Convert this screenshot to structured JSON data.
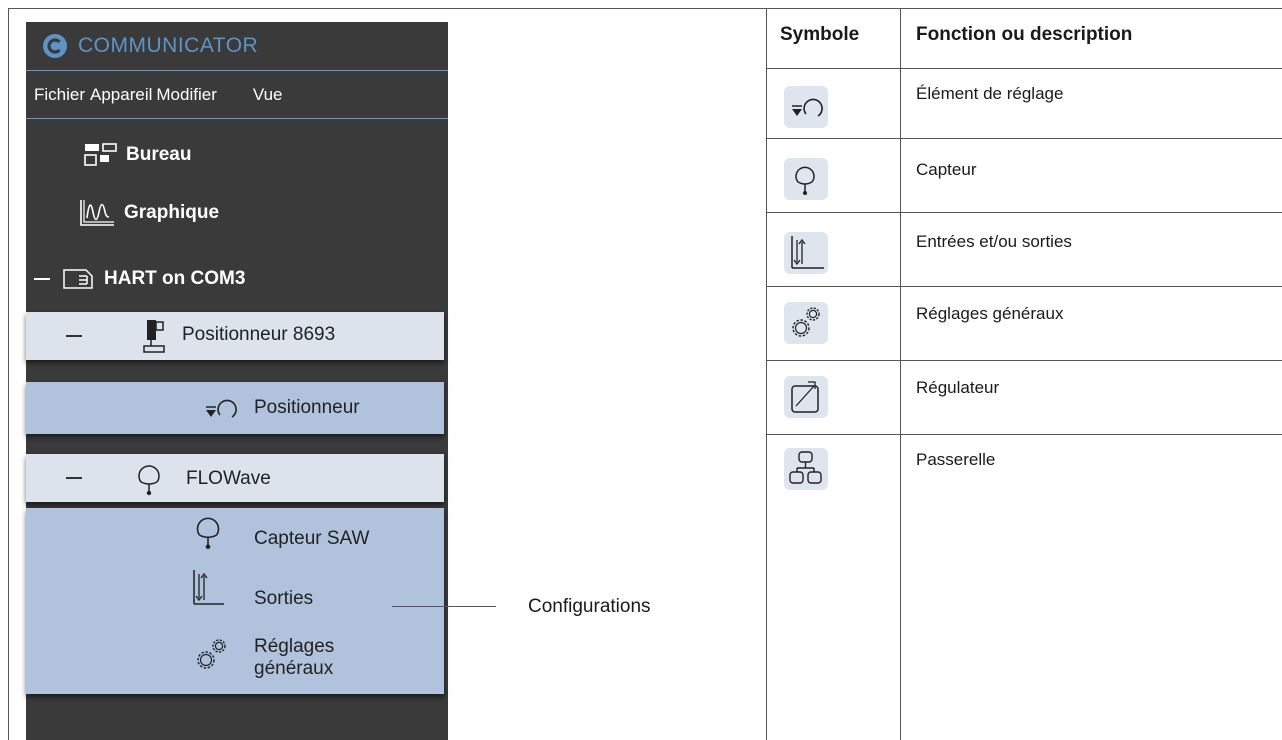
{
  "app": {
    "title": "COMMUNICATOR",
    "menu": [
      "Fichier",
      "Appareil",
      "Modifier",
      "Vue"
    ],
    "nav": {
      "desktop": "Bureau",
      "chart": "Graphique",
      "connection": "HART on COM3"
    },
    "tree": {
      "device1": "Positionneur 8693",
      "device1_child": "Positionneur",
      "device2": "FLOWave",
      "device2_children": [
        "Capteur SAW",
        "Sorties",
        "Réglages généraux"
      ]
    }
  },
  "callout": "Configurations",
  "table": {
    "headers": [
      "Symbole",
      "Fonction ou description"
    ],
    "rows": [
      {
        "icon": "actuator-control-icon",
        "text": "Élément de réglage"
      },
      {
        "icon": "sensor-icon",
        "text": "Capteur"
      },
      {
        "icon": "inputs-outputs-icon",
        "text": "Entrées et/ou sorties"
      },
      {
        "icon": "gears-icon",
        "text": "Réglages généraux"
      },
      {
        "icon": "controller-icon",
        "text": "Régulateur"
      },
      {
        "icon": "gateway-icon",
        "text": "Passerelle"
      }
    ]
  },
  "colors": {
    "app_bg": "#3a3a3a",
    "accent": "#5e93c6",
    "tree_light": "#dde3ec",
    "tree_dark": "#b1c3dc"
  }
}
